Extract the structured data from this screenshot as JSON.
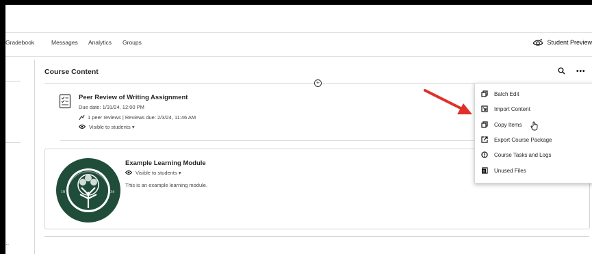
{
  "nav": {
    "items": [
      "Gradebook",
      "Messages",
      "Analytics",
      "Groups"
    ],
    "student_preview": "Student Preview"
  },
  "content": {
    "section_title": "Course Content",
    "peer_review": {
      "title": "Peer Review of Writing Assignment",
      "due": "Due date: 1/31/24, 12:00 PM",
      "reviews": "1 peer reviews | Reviews due: 2/3/24, 11:46 AM",
      "visibility": "Visible to students"
    },
    "module": {
      "title": "Example Learning Module",
      "visibility": "Visible to students",
      "description": "This is an example learning module.",
      "logo_text": "JACKSONVILLE UNIVERSITY 1934"
    }
  },
  "menu": {
    "items": [
      "Batch Edit",
      "Import Content",
      "Copy Items",
      "Export Course Package",
      "Course Tasks and Logs",
      "Unused Files"
    ]
  },
  "colors": {
    "arrow": "#e0302a",
    "logo_green": "#1f4d3a"
  }
}
